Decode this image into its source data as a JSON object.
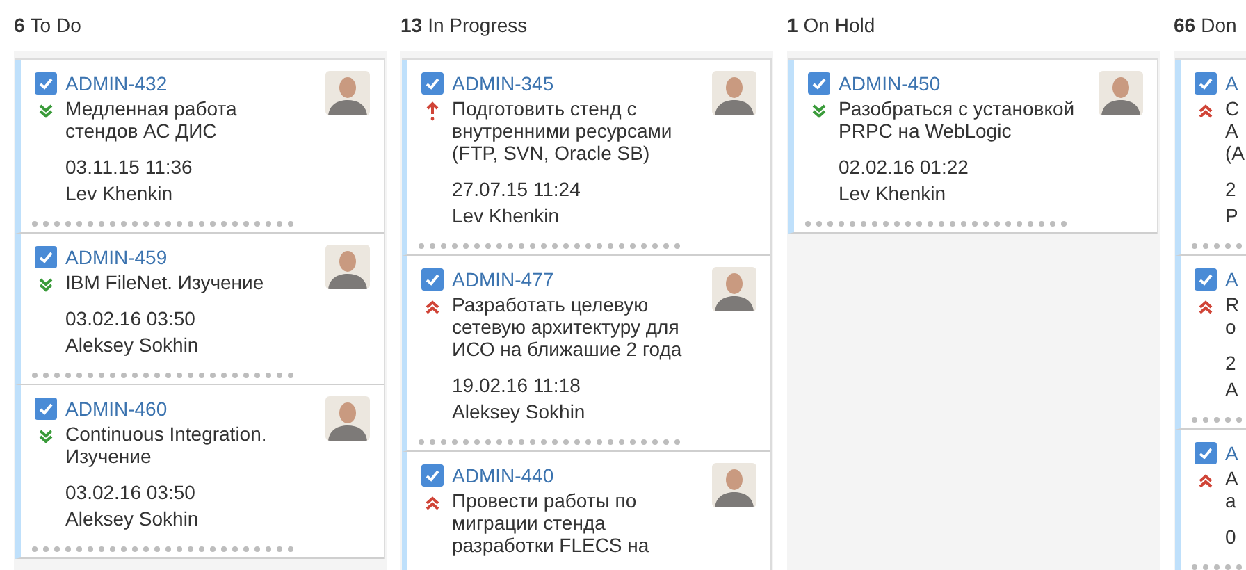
{
  "columns": [
    {
      "count": "6",
      "title": "To Do",
      "cards": [
        {
          "key": "ADMIN-432",
          "kind": "lowest",
          "summary": "Медленная работа стендов АС ДИС",
          "date": "03.11.15 11:36",
          "assignee": "Lev Khenkin"
        },
        {
          "key": "ADMIN-459",
          "kind": "lowest",
          "summary": "IBM FileNet. Изучение",
          "date": "03.02.16 03:50",
          "assignee": "Aleksey Sokhin"
        },
        {
          "key": "ADMIN-460",
          "kind": "lowest",
          "summary": "Continuous Integration. Изучение",
          "date": "03.02.16 03:50",
          "assignee": "Aleksey Sokhin"
        }
      ]
    },
    {
      "count": "13",
      "title": "In Progress",
      "cards": [
        {
          "key": "ADMIN-345",
          "kind": "critical",
          "summary": "Подготовить стенд с внутренними ресурсами (FTP, SVN, Oracle SB)",
          "date": "27.07.15 11:24",
          "assignee": "Lev Khenkin"
        },
        {
          "key": "ADMIN-477",
          "kind": "highest",
          "summary": "Разработать целевую сетевую архитектуру для ИСО на ближашие 2 года",
          "date": "19.02.16 11:18",
          "assignee": "Aleksey Sokhin"
        },
        {
          "key": "ADMIN-440",
          "kind": "highest",
          "summary": "Провести работы по миграции стенда разработки FLECS на"
        }
      ]
    },
    {
      "count": "1",
      "title": "On Hold",
      "cards": [
        {
          "key": "ADMIN-450",
          "kind": "lowest",
          "summary": "Разобраться с установкой PRPC на WebLogic",
          "date": "02.02.16 01:22",
          "assignee": "Lev Khenkin"
        }
      ]
    },
    {
      "count": "66",
      "title": "Don",
      "cards": [
        {
          "key": "A",
          "kind": "highest",
          "summary": "C\nA\n(A",
          "date": "2",
          "assignee": "P"
        },
        {
          "key": "A",
          "kind": "highest",
          "summary": "R\nо",
          "date": "2",
          "assignee": "A"
        },
        {
          "key": "A",
          "kind": "highest",
          "summary": "A\nа",
          "date": "0"
        }
      ]
    }
  ]
}
